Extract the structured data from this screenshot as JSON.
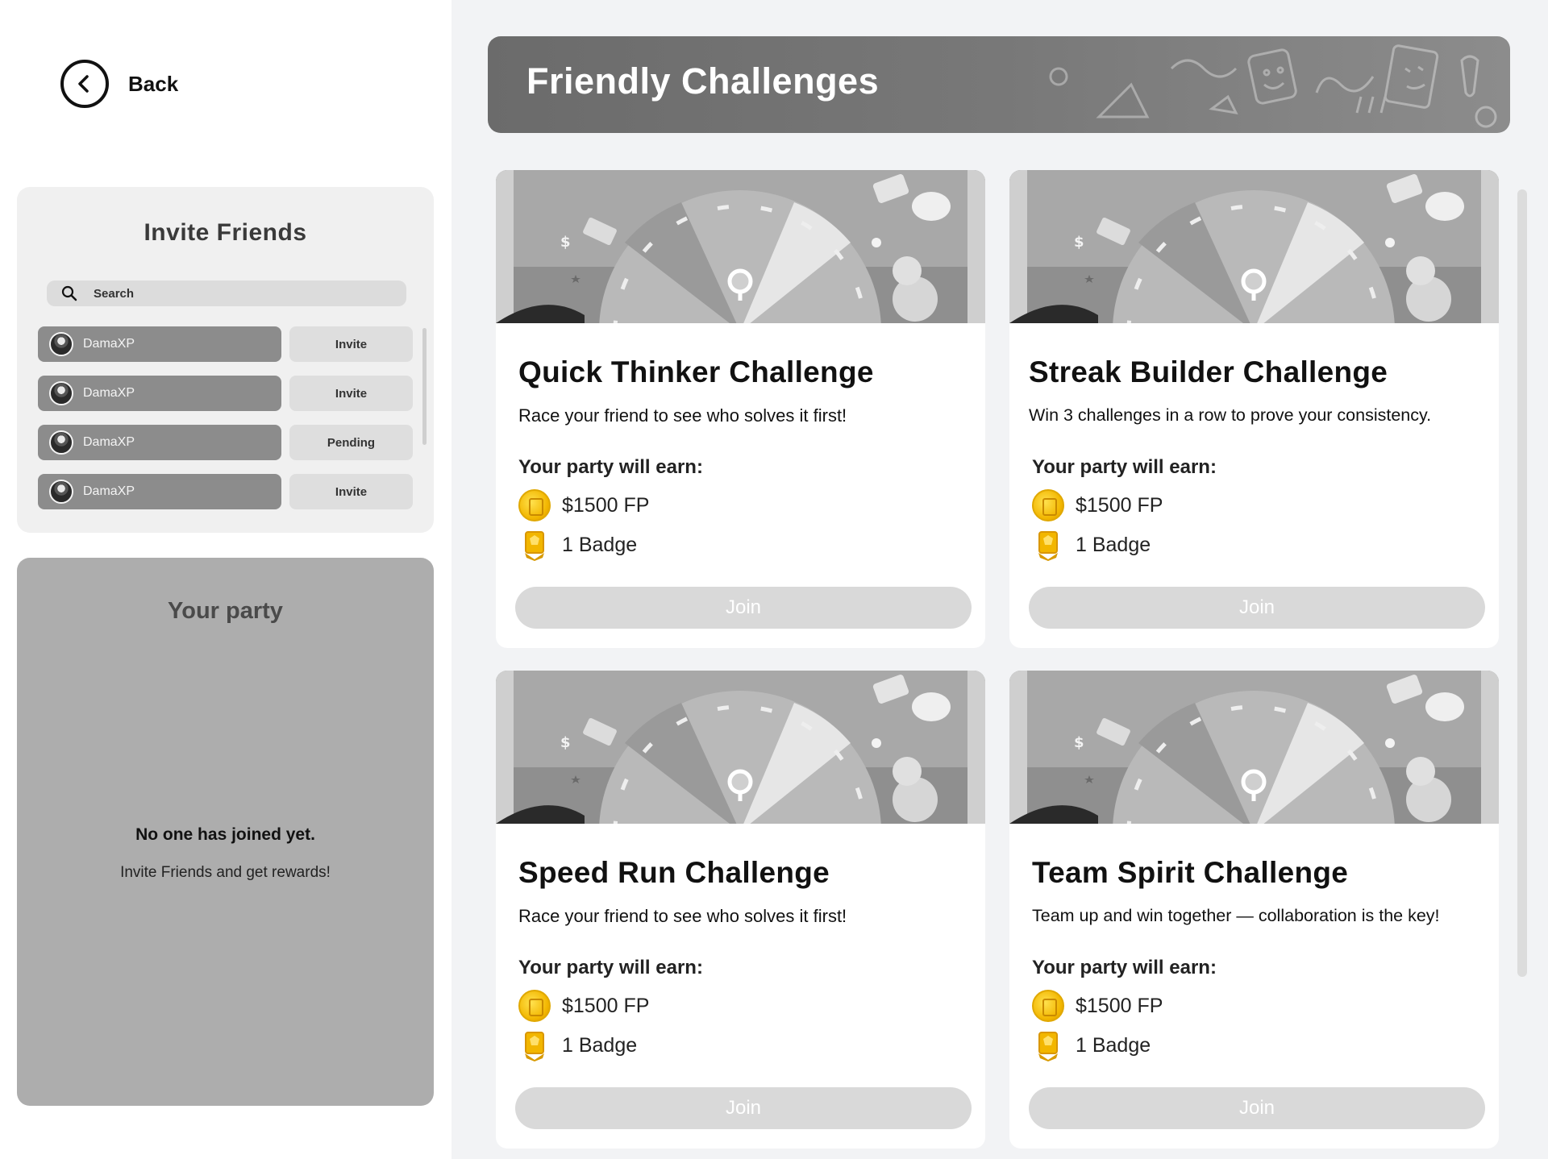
{
  "nav": {
    "back_label": "Back"
  },
  "invite": {
    "title": "Invite Friends",
    "search_placeholder": "Search",
    "friends": [
      {
        "name": "DamaXP",
        "action": "Invite"
      },
      {
        "name": "DamaXP",
        "action": "Invite"
      },
      {
        "name": "DamaXP",
        "action": "Pending"
      },
      {
        "name": "DamaXP",
        "action": "Invite"
      }
    ]
  },
  "party": {
    "title": "Your party",
    "empty_title": "No one has joined yet.",
    "empty_subtitle": "Invite Friends and get rewards!"
  },
  "banner": {
    "title": "Friendly Challenges"
  },
  "challenges": [
    {
      "title": "Quick Thinker Challenge",
      "description": "Race your friend to see who solves it first!",
      "earn_label": "Your party will earn:",
      "fp": "$1500 FP",
      "badge": "1 Badge",
      "join_label": "Join"
    },
    {
      "title": "Streak Builder Challenge",
      "description": "Win 3 challenges in a row to prove your consistency.",
      "earn_label": "Your party will earn:",
      "fp": "$1500 FP",
      "badge": "1 Badge",
      "join_label": "Join"
    },
    {
      "title": "Speed Run Challenge",
      "description": "Race your friend to see who solves it first!",
      "earn_label": "Your party will earn:",
      "fp": "$1500 FP",
      "badge": "1 Badge",
      "join_label": "Join"
    },
    {
      "title": "Team Spirit Challenge",
      "description": "Team up and win together — collaboration is the key!",
      "earn_label": "Your party will earn:",
      "fp": "$1500 FP",
      "badge": "1 Badge",
      "join_label": "Join"
    }
  ],
  "colors": {
    "page_bg": "#f2f3f5",
    "banner": "#787878",
    "friend_chip": "#8c8c8c",
    "party_panel": "#adadad",
    "join_button": "#d9d9d9",
    "coin": "#f2b600"
  }
}
